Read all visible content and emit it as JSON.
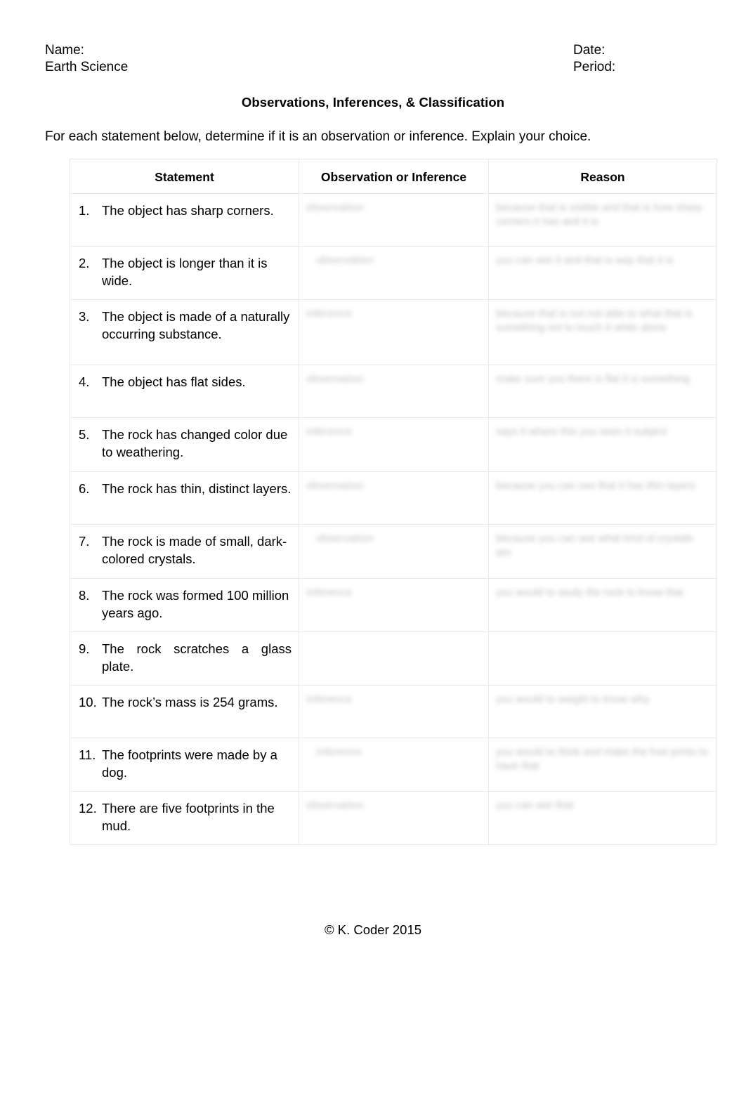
{
  "header": {
    "name_label": "Name:",
    "course_label": "Earth Science",
    "date_label": "Date:",
    "period_label": "Period:"
  },
  "title": "Observations, Inferences, & Classification",
  "directions": "For each statement below, determine if it is an observation or inference. Explain your choice.",
  "table": {
    "columns": [
      {
        "id": "statement",
        "label": "Statement"
      },
      {
        "id": "type",
        "label": "Observation or Inference"
      },
      {
        "id": "reason",
        "label": "Reason"
      }
    ],
    "rows": [
      {
        "number": "1.",
        "statement": "The object has sharp corners.",
        "answer_type": "observation",
        "answer_reason": "because that is visible and that is how sharp corners it has and it is",
        "filled": true
      },
      {
        "number": "2.",
        "statement": "The object is longer than it is wide.",
        "answer_type": "observation",
        "answer_reason": "you can see it and that is way that it is",
        "filled": true
      },
      {
        "number": "3.",
        "statement": "The object is made of a naturally occurring substance.",
        "answer_type": "inference",
        "answer_reason": "because that is not not able to what that is something not to touch it while alone",
        "filled": true
      },
      {
        "number": "4.",
        "statement": "The object has flat sides.",
        "answer_type": "observation",
        "answer_reason": "make sure you there is flat it is something",
        "filled": true
      },
      {
        "number": "5.",
        "statement": "The rock has changed color due to weathering.",
        "answer_type": "inference",
        "answer_reason": "says it where this you seen it subject",
        "filled": true
      },
      {
        "number": "6.",
        "statement": "The rock has thin, distinct layers.",
        "answer_type": "observation",
        "answer_reason": "because you can see that it has thin layers",
        "filled": true
      },
      {
        "number": "7.",
        "statement": "The rock is made of small, dark-colored crystals.",
        "answer_type": "observation",
        "answer_reason": "because you can see what kind of crystals are",
        "filled": true
      },
      {
        "number": "8.",
        "statement": "The rock was formed 100 million years ago.",
        "answer_type": "inference",
        "answer_reason": "you would to study the rock to know that",
        "filled": true
      },
      {
        "number": "9.",
        "statement": "The rock scratches a glass plate.",
        "answer_type": "",
        "answer_reason": "",
        "filled": false
      },
      {
        "number": "10.",
        "statement": "The rock’s mass is 254 grams.",
        "answer_type": "inference",
        "answer_reason": "you would to weight to know why",
        "filled": true
      },
      {
        "number": "11.",
        "statement": "The footprints were made by a dog.",
        "answer_type": "inference",
        "answer_reason": "you would to think and make the foot prints to have that",
        "filled": true
      },
      {
        "number": "12.",
        "statement": "There are five footprints in the mud.",
        "answer_type": "observation",
        "answer_reason": "you can see that",
        "filled": true
      }
    ]
  },
  "footer": "© K. Coder 2015"
}
